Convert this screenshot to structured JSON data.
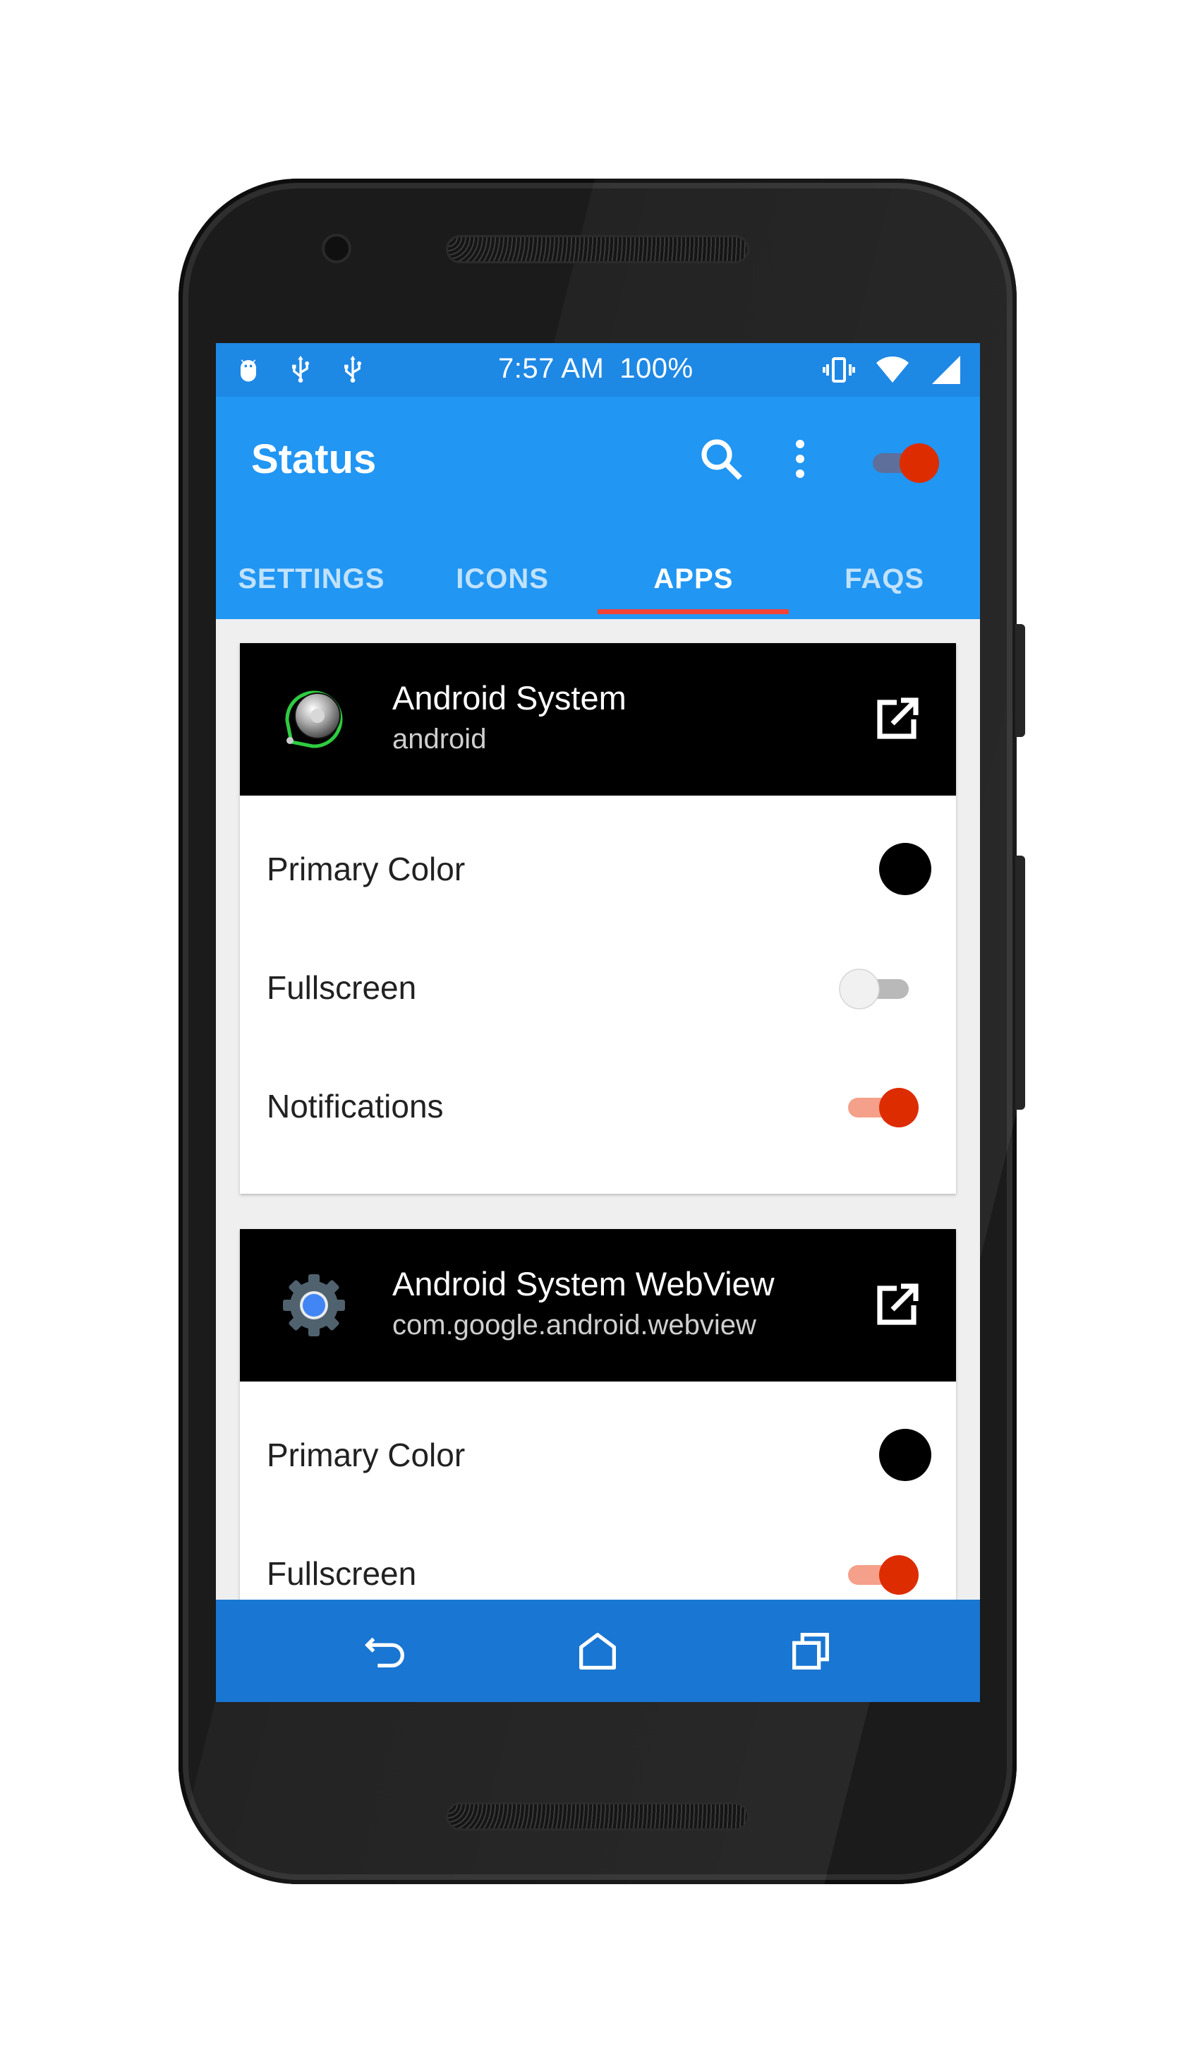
{
  "status_bar": {
    "time": "7:57 AM",
    "battery": "100%",
    "left_icons": [
      "android-debug-icon",
      "usb-icon",
      "usb-icon"
    ],
    "right_icons": [
      "vibrate-icon",
      "wifi-icon",
      "cell-signal-icon"
    ]
  },
  "app_bar": {
    "title": "Status",
    "search_icon": "search-icon",
    "more_icon": "more-vert-icon",
    "master_switch_on": true
  },
  "tabs": [
    {
      "label": "SETTINGS",
      "active": false
    },
    {
      "label": "ICONS",
      "active": false
    },
    {
      "label": "APPS",
      "active": true
    },
    {
      "label": "FAQS",
      "active": false
    }
  ],
  "apps": [
    {
      "name": "Android System",
      "package": "android",
      "icon": "android-system-icon",
      "rows": {
        "primary_color_label": "Primary Color",
        "primary_color": "#000000",
        "fullscreen_label": "Fullscreen",
        "fullscreen_on": false,
        "notifications_label": "Notifications",
        "notifications_on": true
      }
    },
    {
      "name": "Android System WebView",
      "package": "com.google.android.webview",
      "icon": "webview-gear-icon",
      "rows": {
        "primary_color_label": "Primary Color",
        "primary_color": "#000000",
        "fullscreen_label": "Fullscreen",
        "fullscreen_on": true
      }
    }
  ],
  "colors": {
    "primary": "#2196f3",
    "primary_dark": "#1e88e5",
    "nav_bar": "#1976d2",
    "accent": "#dd2c00",
    "tab_indicator": "#f44336"
  },
  "nav_bar": [
    "back-icon",
    "home-icon",
    "recents-icon"
  ]
}
